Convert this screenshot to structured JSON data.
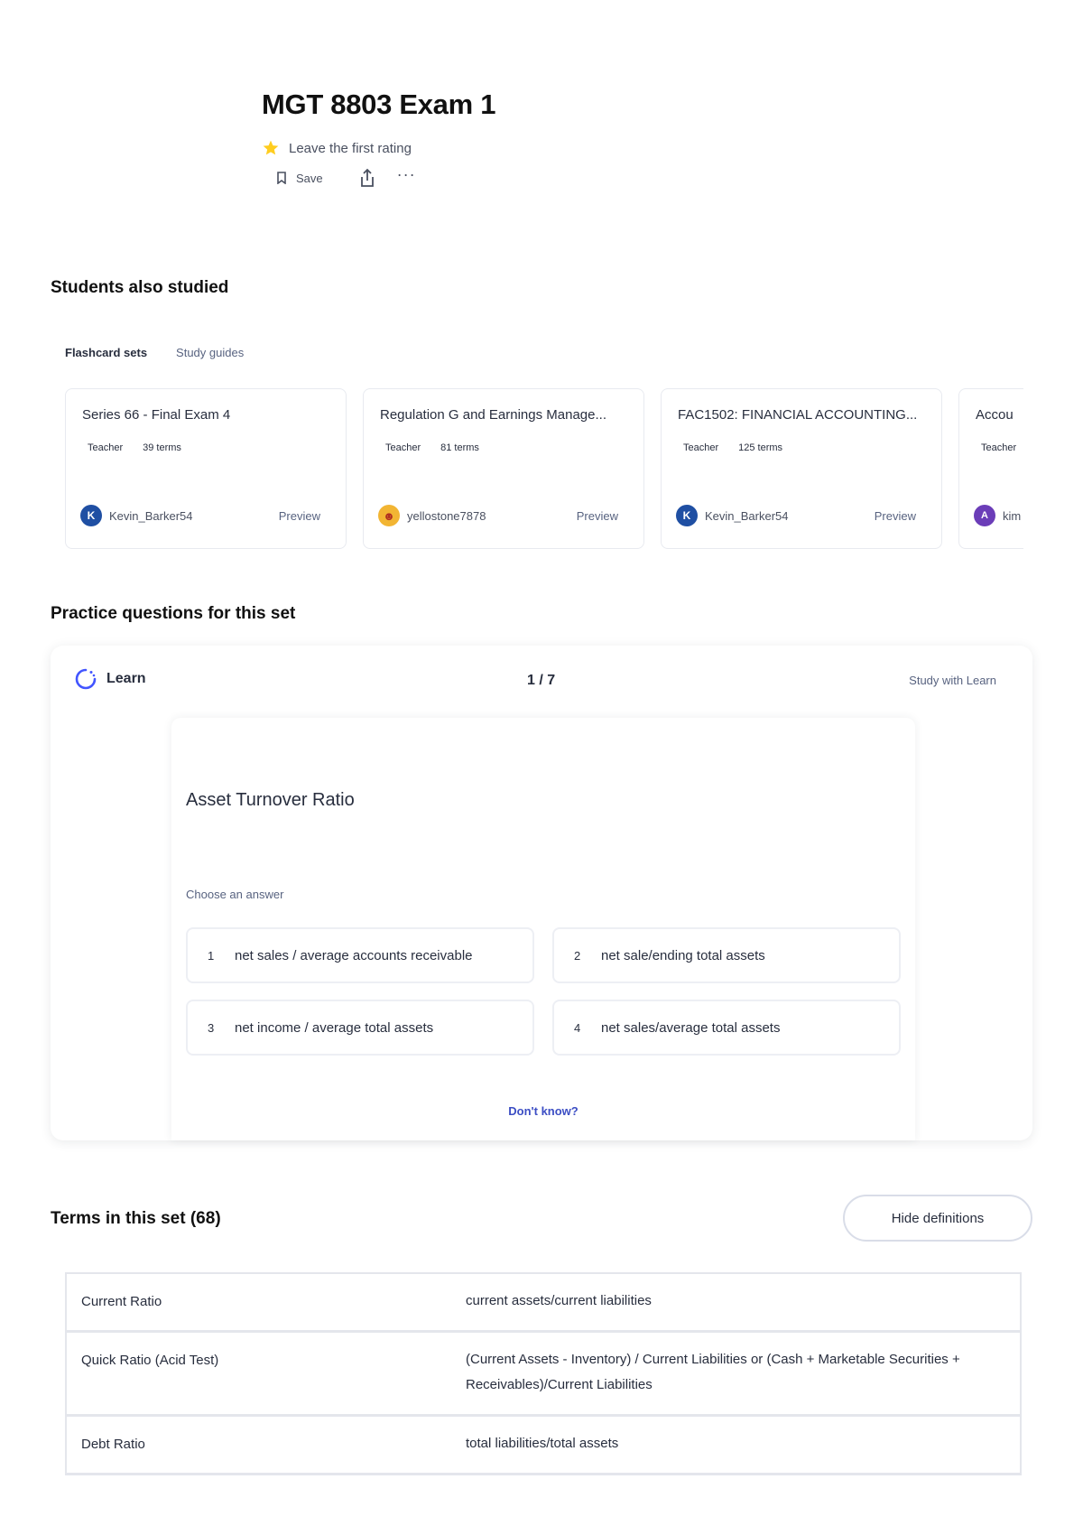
{
  "set": {
    "title": "MGT 8803 Exam 1",
    "rating_text": "Leave the first rating",
    "save_label": "Save",
    "more_label": "···"
  },
  "students_also_studied": {
    "heading": "Students also studied",
    "tabs": [
      {
        "label": "Flashcard sets",
        "active": true
      },
      {
        "label": "Study guides",
        "active": false
      }
    ],
    "cards": [
      {
        "title": "Series 66 - Final Exam 4",
        "role": "Teacher",
        "terms": "39 terms",
        "user": "Kevin_Barker54",
        "avatar_letter": "K",
        "preview": "Preview"
      },
      {
        "title": "Regulation G and Earnings Manage...",
        "role": "Teacher",
        "terms": "81 terms",
        "user": "yellostone7878",
        "avatar_letter": "☻",
        "preview": "Preview"
      },
      {
        "title": "FAC1502: FINANCIAL ACCOUNTING...",
        "role": "Teacher",
        "terms": "125 terms",
        "user": "Kevin_Barker54",
        "avatar_letter": "K",
        "preview": "Preview"
      },
      {
        "title": "Accou",
        "role": "Teacher",
        "terms": "",
        "user": "kim",
        "avatar_letter": "A",
        "preview": ""
      }
    ]
  },
  "practice": {
    "heading": "Practice questions for this set",
    "mode_label": "Learn",
    "progress": "1 / 7",
    "study_link": "Study with Learn",
    "term": "Asset Turnover Ratio",
    "prompt": "Choose an answer",
    "options": [
      {
        "num": "1",
        "text": "net sales / average accounts receivable"
      },
      {
        "num": "2",
        "text": "net sale/ending total assets"
      },
      {
        "num": "3",
        "text": "net income / average total assets"
      },
      {
        "num": "4",
        "text": "net sales/average total assets"
      }
    ],
    "dont_know": "Don't know?"
  },
  "terms": {
    "heading": "Terms in this set (68)",
    "hide_definitions_label": "Hide definitions",
    "rows": [
      {
        "term": "Current Ratio",
        "definition": "current assets/current liabilities"
      },
      {
        "term": "Quick Ratio (Acid Test)",
        "definition": "(Current Assets - Inventory) / Current Liabilities or (Cash + Marketable Securities + Receivables)/Current Liabilities"
      },
      {
        "term": "Debt Ratio",
        "definition": "total liabilities/total assets"
      }
    ]
  },
  "colors": {
    "accent": "#3c4ec4",
    "star": "#ffcd1f",
    "text": "#282e3e"
  }
}
